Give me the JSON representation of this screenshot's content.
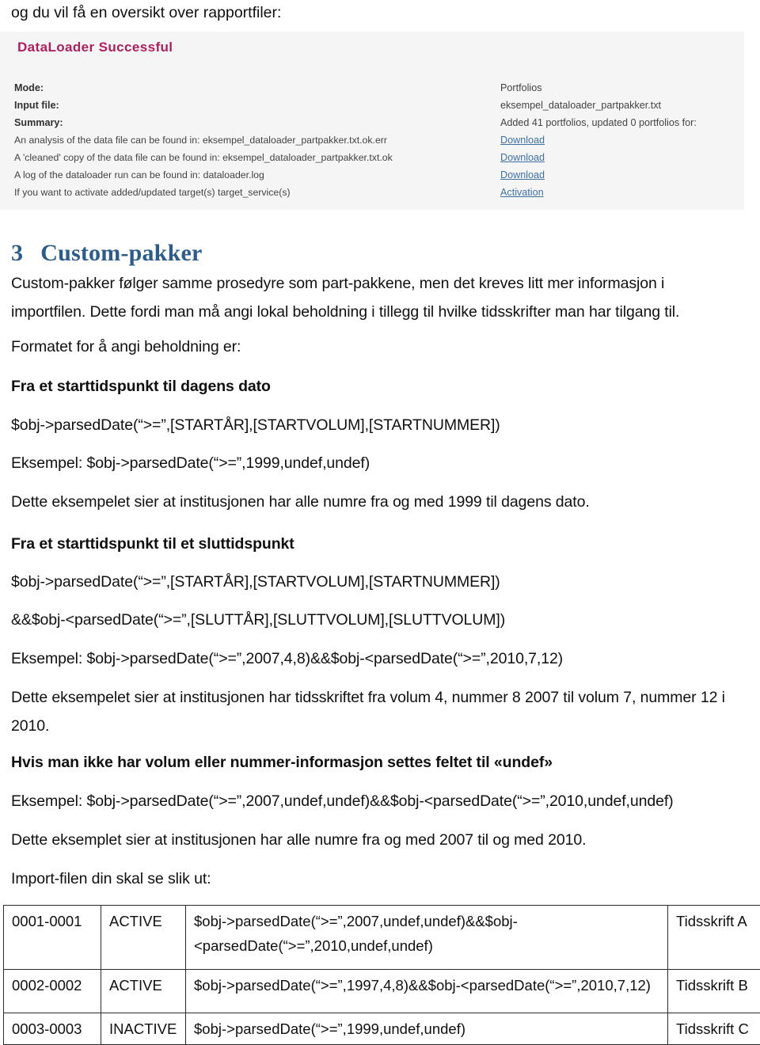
{
  "document": {
    "intro_line": "og du vil få en oversikt over rapportfiler:"
  },
  "screenshot": {
    "title": "DataLoader Successful",
    "title_color": "#b0185c",
    "link_color": "#3a6fa5",
    "left_rows": [
      "Mode:",
      "Input file:",
      "Summary:",
      "An analysis of the data file can be found in: eksempel_dataloader_partpakker.txt.ok.err",
      "A 'cleaned' copy of the data file can be found in: eksempel_dataloader_partpakker.txt.ok",
      "A log of the dataloader run can be found in: dataloader.log",
      "If you want to activate added/updated target(s) target_service(s)"
    ],
    "right_rows": [
      "Portfolios",
      "eksempel_dataloader_partpakker.txt",
      "Added 41 portfolios, updated 0 portfolios for:",
      "Download",
      "Download",
      "Download",
      "Activation"
    ]
  },
  "section": {
    "number": "3",
    "title": "Custom-pakker",
    "paragraph_1": "Custom-pakker følger samme prosedyre som part-pakkene, men det kreves litt mer informasjon i importfilen. Dette fordi man må angi lokal beholdning i tillegg til hvilke tidsskrifter man har tilgang til.",
    "paragraph_2": "Formatet for å angi beholdning er:",
    "sub_1_heading": "Fra et starttidspunkt til dagens dato",
    "sub_1_format": "$obj->parsedDate(“>=”,[STARTÅR],[STARTVOLUM],[STARTNUMMER])",
    "sub_1_example": "Eksempel: $obj->parsedDate(“>=”,1999,undef,undef)",
    "sub_1_explain": "Dette eksempelet sier at institusjonen har alle numre fra og med 1999 til dagens dato.",
    "sub_2_heading": "Fra et starttidspunkt til et sluttidspunkt",
    "sub_2_format_line1": "$obj->parsedDate(“>=”,[STARTÅR],[STARTVOLUM],[STARTNUMMER])",
    "sub_2_format_line2": "&&$obj-<parsedDate(“>=”,[SLUTTÅR],[SLUTTVOLUM],[SLUTTVOLUM])",
    "sub_2_example": "Eksempel: $obj->parsedDate(“>=”,2007,4,8)&&$obj-<parsedDate(“>=”,2010,7,12)",
    "sub_2_explain": "Dette eksempelet sier at institusjonen har tidsskriftet fra volum 4, nummer 8 2007 til volum 7, nummer 12 i 2010.",
    "sub_3_heading": "Hvis man ikke har volum eller nummer-informasjon settes feltet til «undef»",
    "sub_3_example": "Eksempel: $obj->parsedDate(“>=”,2007,undef,undef)&&$obj-<parsedDate(“>=”,2010,undef,undef)",
    "sub_3_explain": "Dette eksemplet sier at institusjonen har alle numre fra og med 2007 til og med 2010.",
    "import_intro": "Import-filen din skal se slik ut:"
  },
  "table": {
    "rows": [
      {
        "id": "0001-0001",
        "state": "ACTIVE",
        "expression": "$obj->parsedDate(“>=”,2007,undef,undef)&&$obj-<parsedDate(“>=”,2010,undef,undef)",
        "name": "Tidsskrift A"
      },
      {
        "id": "0002-0002",
        "state": "ACTIVE",
        "expression": "$obj->parsedDate(“>=”,1997,4,8)&&$obj-<parsedDate(“>=”,2010,7,12)",
        "name": "Tidsskrift B"
      },
      {
        "id": "0003-0003",
        "state": "INACTIVE",
        "expression": "$obj->parsedDate(“>=”,1999,undef,undef)",
        "name": "Tidsskrift C"
      }
    ]
  }
}
